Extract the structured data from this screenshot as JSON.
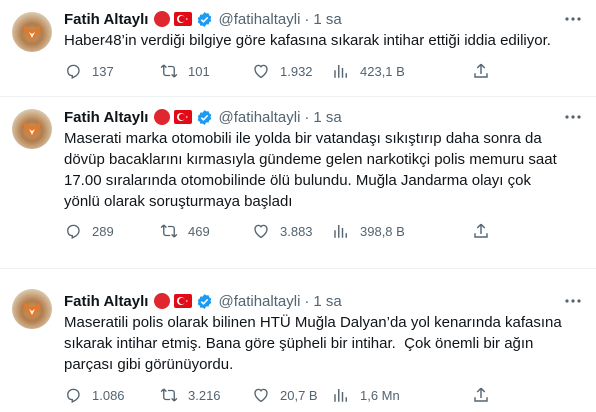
{
  "accent": "#1d9bf0",
  "tweets": [
    {
      "name": "Fatih Altaylı",
      "handle": "@fatihaltayli",
      "separator": "·",
      "time": "1 sa",
      "text": "Haber48’in verdiği bilgiye göre kafasına sıkarak intihar ettiği iddia ediliyor.",
      "replies": "137",
      "retweets": "101",
      "likes": "1.932",
      "views": "423,1 B"
    },
    {
      "name": "Fatih Altaylı",
      "handle": "@fatihaltayli",
      "separator": "·",
      "time": "1 sa",
      "text": "Maserati marka otomobili ile yolda bir vatandaşı sıkıştırıp daha sonra da\ndövüp bacaklarını kırmasıyla gündeme gelen narkotikçi polis memuru saat\n17.00 sıralarında otomobilinde ölü bulundu. Muğla Jandarma olayı çok\nyönlü olarak soruşturmaya başladı",
      "replies": "289",
      "retweets": "469",
      "likes": "3.883",
      "views": "398,8 B"
    },
    {
      "name": "Fatih Altaylı",
      "handle": "@fatihaltayli",
      "separator": "·",
      "time": "1 sa",
      "text": "Maseratili polis olarak bilinen HTÜ Muğla Dalyan’da yol kenarında kafasına\nsıkarak intihar etmiş. Bana göre şüpheli bir intihar.  Çok önemli bir ağın\nparçası gibi görünüyordu.",
      "replies": "1.086",
      "retweets": "3.216",
      "likes": "20,7 B",
      "views": "1,6 Mn"
    }
  ]
}
